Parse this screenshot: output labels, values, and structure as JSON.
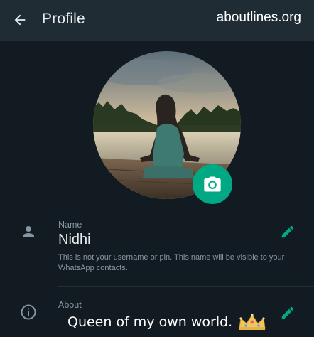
{
  "header": {
    "title": "Profile",
    "watermark": "aboutlines.org",
    "back_icon": "arrow-left-icon"
  },
  "avatar": {
    "camera_icon": "camera-icon"
  },
  "name_section": {
    "label": "Name",
    "value": "Nidhi",
    "hint": "This is not your username or pin. This name will be visible to your WhatsApp contacts.",
    "icon": "person-icon",
    "edit_icon": "pencil-icon"
  },
  "about_section": {
    "label": "About",
    "value": "Queen of my own world.",
    "icon": "info-icon",
    "edit_icon": "pencil-icon",
    "emoji": "crown-icon"
  },
  "colors": {
    "background": "#121b22",
    "header": "#1f2c34",
    "accent": "#00a884",
    "secondary_text": "#8696a0"
  }
}
